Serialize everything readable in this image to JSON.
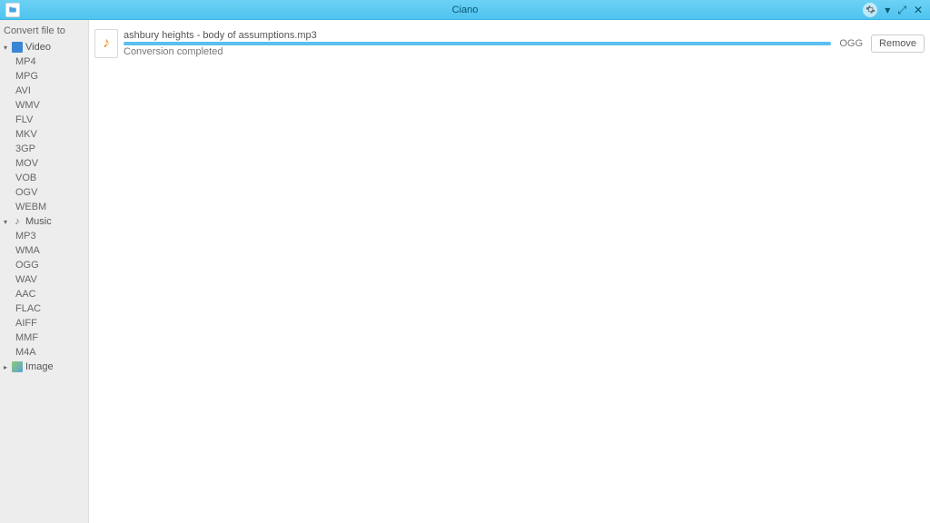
{
  "titlebar": {
    "title": "Ciano"
  },
  "sidebar": {
    "header": "Convert file to",
    "categories": [
      {
        "label": "Video",
        "icon": "video",
        "expanded": true,
        "formats": [
          "MP4",
          "MPG",
          "AVI",
          "WMV",
          "FLV",
          "MKV",
          "3GP",
          "MOV",
          "VOB",
          "OGV",
          "WEBM"
        ]
      },
      {
        "label": "Music",
        "icon": "music",
        "expanded": true,
        "formats": [
          "MP3",
          "WMA",
          "OGG",
          "WAV",
          "AAC",
          "FLAC",
          "AIFF",
          "MMF",
          "M4A"
        ]
      },
      {
        "label": "Image",
        "icon": "image",
        "expanded": false,
        "formats": []
      }
    ]
  },
  "items": [
    {
      "filename": "ashbury heights - body of assumptions.mp3",
      "status": "Conversion completed",
      "target_format": "OGG",
      "remove_label": "Remove",
      "progress_pct": 100
    }
  ]
}
